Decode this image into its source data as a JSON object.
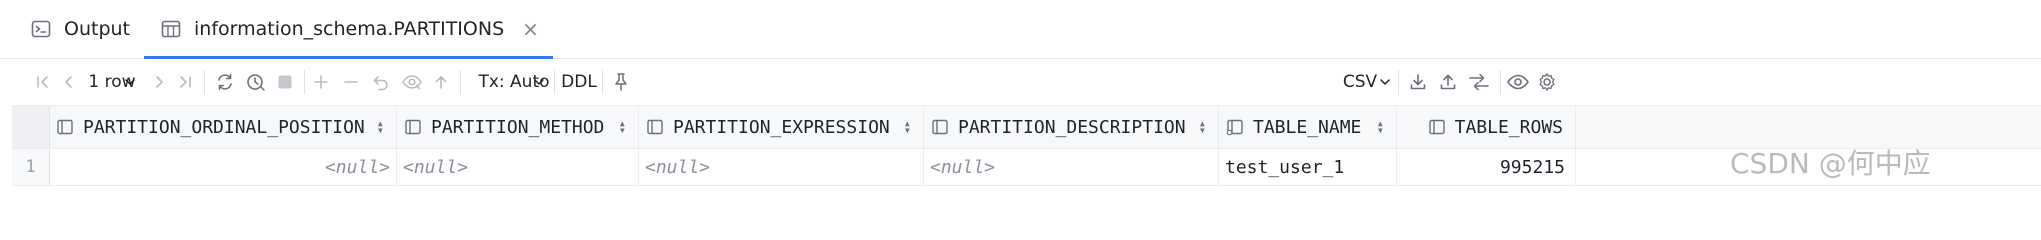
{
  "tabs": [
    {
      "label": "Output",
      "icon": "console-icon"
    },
    {
      "label": "information_schema.PARTITIONS",
      "icon": "table-icon",
      "active": true,
      "close": "×"
    }
  ],
  "toolbar": {
    "rows_label": "1 row",
    "tx_label": "Tx: Auto",
    "ddl_label": "DDL",
    "format_label": "CSV"
  },
  "grid": {
    "columns": [
      "PARTITION_ORDINAL_POSITION",
      "PARTITION_METHOD",
      "PARTITION_EXPRESSION",
      "PARTITION_DESCRIPTION",
      "TABLE_NAME",
      "TABLE_ROWS"
    ],
    "rows": [
      {
        "num": "1",
        "cells": [
          "<null>",
          "<null>",
          "<null>",
          "<null>",
          "test_user_1",
          "995215"
        ]
      }
    ]
  },
  "watermark": "CSDN @何中应",
  "colors": {
    "accent": "#3574f0",
    "null_text": "#8c8f99",
    "header_bg": "#f7f8fa"
  }
}
